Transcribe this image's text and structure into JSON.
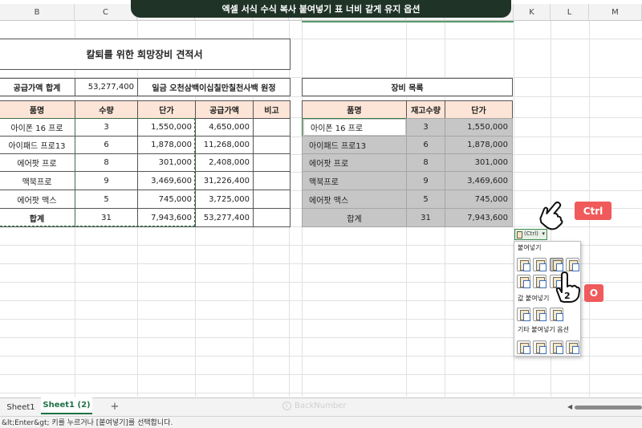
{
  "title_banner": "엑셀 서식 수식 복사 붙여넣기 표 너비 같게 유지 옵션",
  "columns": [
    "B",
    "C",
    "",
    "",
    "",
    "",
    "",
    "",
    "",
    "K",
    "L",
    "M"
  ],
  "left": {
    "title": "칼퇴를 위한 희망장비 견적서",
    "summary_label": "공급가액 합계",
    "summary_value": "53,277,400",
    "summary_text": "일금 오천삼백이십칠만칠천사백 원정",
    "headers": [
      "품명",
      "수량",
      "단가",
      "공급가액",
      "비고"
    ],
    "rows": [
      [
        "아이폰 16 프로",
        "3",
        "1,550,000",
        "4,650,000",
        ""
      ],
      [
        "아이패드 프로13",
        "6",
        "1,878,000",
        "11,268,000",
        ""
      ],
      [
        "에어팟 프로",
        "8",
        "301,000",
        "2,408,000",
        ""
      ],
      [
        "맥북프로",
        "9",
        "3,469,600",
        "31,226,400",
        ""
      ],
      [
        "에어팟 맥스",
        "5",
        "745,000",
        "3,725,000",
        ""
      ]
    ],
    "total": [
      "합계",
      "31",
      "7,943,600",
      "53,277,400",
      ""
    ]
  },
  "right": {
    "title": "장비 목록",
    "headers": [
      "품명",
      "재고수량",
      "단가"
    ],
    "rows": [
      [
        "아이폰 16 프로",
        "3",
        "1,550,000"
      ],
      [
        "아이패드 프로13",
        "6",
        "1,878,000"
      ],
      [
        "에어팟 프로",
        "8",
        "301,000"
      ],
      [
        "맥북프로",
        "9",
        "3,469,600"
      ],
      [
        "에어팟 맥스",
        "5",
        "745,000"
      ]
    ],
    "total": [
      "합계",
      "31",
      "7,943,600"
    ]
  },
  "paste_tag": {
    "label": "(Ctrl)"
  },
  "ctrl_badge": "Ctrl",
  "o_badge": "O",
  "step_number": "2",
  "paste_menu": {
    "section_paste": "붙여넣기",
    "section_values": "값 붙여넣기",
    "section_other": "기타 붙여넣기 옵션"
  },
  "sheet_tabs": [
    "Sheet1",
    "Sheet1 (2)"
  ],
  "add_sheet": "+",
  "watermark": "BackNumber",
  "status_text": "&lt;Enter&gt; 키를 누르거나 [붙여넣기]를 선택합니다."
}
